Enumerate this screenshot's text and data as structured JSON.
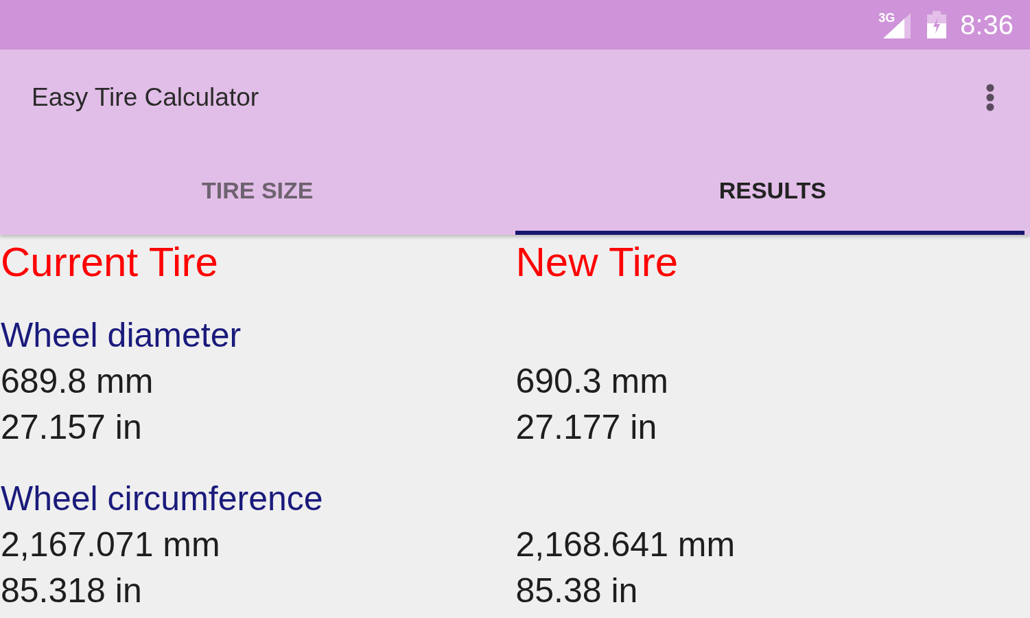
{
  "status_bar": {
    "network": "3G",
    "time": "8:36"
  },
  "app_bar": {
    "title": "Easy Tire Calculator"
  },
  "tabs": [
    {
      "label": "TIRE SIZE",
      "selected": false
    },
    {
      "label": "RESULTS",
      "selected": true
    }
  ],
  "results": {
    "columns": [
      "Current Tire",
      "New Tire"
    ],
    "sections": [
      {
        "label": "Wheel diameter",
        "current": [
          "689.8 mm",
          "27.157 in"
        ],
        "new": [
          "690.3 mm",
          "27.177 in"
        ]
      },
      {
        "label": "Wheel circumference",
        "current": [
          "2,167.071 mm",
          "85.318 in"
        ],
        "new": [
          "2,168.641 mm",
          "85.38 in"
        ]
      }
    ]
  }
}
